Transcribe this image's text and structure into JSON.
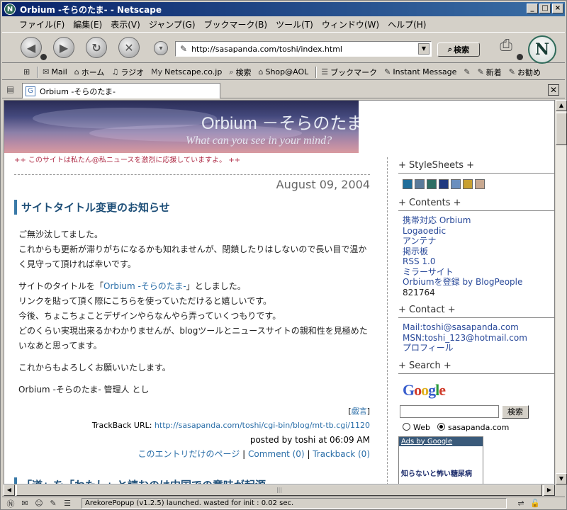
{
  "window": {
    "title": "Orbium -そらのたま- - Netscape",
    "app_icon_letter": "N"
  },
  "menu": [
    "ファイル(F)",
    "編集(E)",
    "表示(V)",
    "ジャンプ(G)",
    "ブックマーク(B)",
    "ツール(T)",
    "ウィンドウ(W)",
    "ヘルプ(H)"
  ],
  "nav": {
    "url": "http://sasapanda.com/toshi/index.html",
    "search_label": "検索",
    "logo_letter": "N"
  },
  "personal_toolbar": [
    {
      "icon": "⊞",
      "label": ""
    },
    {
      "icon": "✉",
      "label": "Mail"
    },
    {
      "icon": "⌂",
      "label": "ホーム"
    },
    {
      "icon": "♫",
      "label": "ラジオ"
    },
    {
      "icon": "My",
      "label": "Netscape.co.jp"
    },
    {
      "icon": "⌕",
      "label": "検索"
    },
    {
      "icon": "⌂",
      "label": "Shop@AOL"
    },
    {
      "icon": "☰",
      "label": "ブックマーク"
    },
    {
      "icon": "✎",
      "label": "Instant Message"
    },
    {
      "icon": "✎",
      "label": ""
    },
    {
      "icon": "✎",
      "label": "新着"
    },
    {
      "icon": "✎",
      "label": "お勧め"
    }
  ],
  "tab": {
    "label": "Orbium -そらのたま-",
    "icon_letter": "G"
  },
  "page": {
    "banner_title": "Orbium －そらのたま－",
    "banner_subtitle": "What can you see in your mind?",
    "promo": "++ このサイトは私たん@私ニュースを激烈に応援していますよ。 ++",
    "date": "August 09, 2004",
    "entry_title": "サイトタイトル変更のお知らせ",
    "paragraphs": [
      {
        "lines": [
          "ご無沙汰してました。",
          "これからも更新が滞りがちになるかも知れませんが、閉鎖したりはしないので長い目で温かく見守って頂ければ幸いです。"
        ]
      },
      {
        "lines_a": "サイトのタイトルを「",
        "link": "Orbium -そらのたま-",
        "lines_b": "」としました。",
        "rest": [
          "リンクを貼って頂く際にこちらを使っていただけると嬉しいです。",
          "今後、ちょこちょことデザインやらなんやら弄っていくつもりです。",
          "どのくらい実現出来るかわかりませんが、blogツールとニュースサイトの親和性を見極めたいなあと思ってます。"
        ]
      },
      {
        "lines": [
          "これからもよろしくお願いいたします。"
        ]
      },
      {
        "lines": [
          "Orbium -そらのたま- 管理人 とし"
        ]
      }
    ],
    "tag_link": "戯言",
    "trackback_prefix": "TrackBack URL: ",
    "trackback_url": "http://sasapanda.com/toshi/cgi-bin/blog/mt-tb.cgi/1120",
    "posted": "posted by toshi at 06:09 AM",
    "footer_links": [
      "このエントリだけのページ",
      "Comment (0)",
      "Trackback (0)"
    ],
    "next_title": "「道」を「わたし」と読むのは中国での意味が起源"
  },
  "sidebar": {
    "stylesheets_title": "+ StyleSheets +",
    "swatches": [
      "#1f6d9a",
      "#5a7a9a",
      "#2e6e64",
      "#203a80",
      "#6a8fbf",
      "#c8a030",
      "#c8a890"
    ],
    "contents_title": "+ Contents +",
    "contents": [
      "携帯対応 Orbium",
      "Logaoedic",
      "アンテナ",
      "掲示板",
      "RSS 1.0",
      "ミラーサイト",
      "Orbiumを登録 by BlogPeople"
    ],
    "counter": "821764",
    "contact_title": "+ Contact +",
    "contact": [
      "Mail:toshi@sasapanda.com",
      "MSN:toshi_123@hotmail.com",
      "プロフィール"
    ],
    "search_title": "+ Search +",
    "google_logo": "Google",
    "search_button": "検索",
    "radio_web": "Web",
    "radio_site": "sasapanda.com",
    "ads_label": "Ads by Google",
    "ad_text": "知らないと怖い糖尿病"
  },
  "status": {
    "text": "ArekorePopup (v1.2.5) launched. wasted for init : 0.02 sec."
  },
  "colors": {
    "accent": "#3a7aa8",
    "link": "#2a6ea8",
    "title_bar": "#0a246a"
  }
}
